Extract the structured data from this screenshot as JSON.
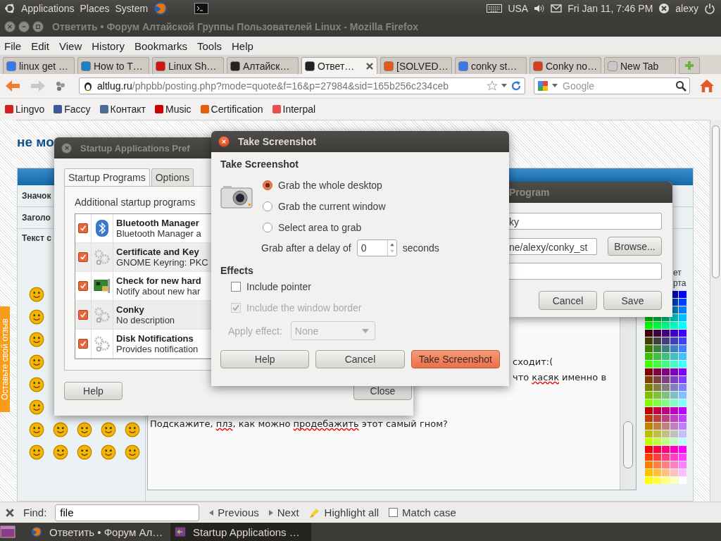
{
  "top_panel": {
    "menus": [
      "Applications",
      "Places",
      "System"
    ],
    "keyboard_layout": "USA",
    "clock": "Fri Jan 11, 7:46 PM",
    "user": "alexy"
  },
  "browser": {
    "title": "Ответить • Форум Алтайской Группы Пользователей Linux - Mozilla Firefox",
    "menu": [
      "File",
      "Edit",
      "View",
      "History",
      "Bookmarks",
      "Tools",
      "Help"
    ],
    "tabs": [
      {
        "label": "linux get …",
        "color": "#3b78e7",
        "selected": false
      },
      {
        "label": "How to T…",
        "color": "#1e7fc4",
        "selected": false
      },
      {
        "label": "Linux Sh…",
        "color": "#d21414",
        "selected": false
      },
      {
        "label": "Алтайск…",
        "color": "#222222",
        "selected": false
      },
      {
        "label": "Ответ…",
        "color": "#222222",
        "selected": true
      },
      {
        "label": "[SOLVED…",
        "color": "#e05a1e",
        "selected": false
      },
      {
        "label": "conky st…",
        "color": "#3b78e7",
        "selected": false
      },
      {
        "label": "Conky no…",
        "color": "#d8401c",
        "selected": false
      },
      {
        "label": "New Tab",
        "color": "#c8c8c8",
        "selected": false
      }
    ],
    "url_host": "altlug.ru",
    "url_path": "/phpbb/posting.php?mode=quote&f=16&p=27984&sid=165b256c234ceb",
    "search_placeholder": "Google",
    "bookmarks": [
      {
        "label": "Lingvo",
        "color": "#d42020"
      },
      {
        "label": "Faccy",
        "color": "#3b5998"
      },
      {
        "label": "Контакт",
        "color": "#4a6e9a"
      },
      {
        "label": "Music",
        "color": "#cc0000"
      },
      {
        "label": "Certification",
        "color": "#e06010"
      },
      {
        "label": "Interpal",
        "color": "#e85050"
      }
    ]
  },
  "page": {
    "heading": "не мо",
    "form_labels": [
      "Значок",
      "Заголо",
      "Текст с"
    ],
    "feedback_tab": "Оставьте свой отзыв",
    "message_lines": [
      {
        "kind": "tail",
        "segments": [
          {
            "text": "сходит:(",
            "misspelled": false
          }
        ]
      },
      {
        "kind": "tail",
        "segments": [
          {
            "text": "что ",
            "misspelled": false
          },
          {
            "text": "касяк",
            "misspelled": true
          },
          {
            "text": " именно в",
            "misspelled": false
          }
        ]
      },
      {
        "kind": "full",
        "segments": [
          {
            "text": "Подскажите, ",
            "misspelled": false
          },
          {
            "text": "плз",
            "misspelled": true
          },
          {
            "text": ", как можно ",
            "misspelled": false
          },
          {
            "text": "продебажить",
            "misspelled": true
          },
          {
            "text": " этот самый гном?",
            "misspelled": false
          }
        ]
      }
    ],
    "palette_labels": [
      "ет",
      "рта"
    ]
  },
  "startup_window": {
    "title": "Startup Applications Pref",
    "tabs": [
      {
        "label": "Startup Programs",
        "selected": true
      },
      {
        "label": "Options",
        "selected": false
      }
    ],
    "intro": "Additional startup programs",
    "items": [
      {
        "name": "Bluetooth Manager",
        "description": "Bluetooth Manager a",
        "checked": true,
        "kind": "bluetooth"
      },
      {
        "name": "Certificate and Key",
        "description": "GNOME Keyring: PKC",
        "checked": true,
        "kind": "gears"
      },
      {
        "name": "Check for new hard",
        "description": "Notify about new har",
        "checked": true,
        "kind": "hardware"
      },
      {
        "name": "Conky",
        "description": "No description",
        "checked": true,
        "kind": "gears"
      },
      {
        "name": "Disk Notifications",
        "description": "Provides notification",
        "checked": true,
        "kind": "gears"
      }
    ],
    "buttons": [
      "Help",
      "Close"
    ]
  },
  "screenshot_dialog": {
    "title": "Take Screenshot",
    "heading": "Take Screenshot",
    "grab_options": [
      {
        "label": "Grab the whole desktop",
        "selected": true
      },
      {
        "label": "Grab the current window",
        "selected": false
      },
      {
        "label": "Select area to grab",
        "selected": false
      }
    ],
    "delay_label": "Grab after a delay of",
    "delay_value": "0",
    "delay_unit": "seconds",
    "effects_heading": "Effects",
    "effects": [
      {
        "label": "Include pointer",
        "checked": false,
        "disabled": false
      },
      {
        "label": "Include the window border",
        "checked": true,
        "disabled": true
      }
    ],
    "apply_effect": {
      "label": "Apply effect:",
      "value": "None",
      "disabled": true
    },
    "buttons": [
      {
        "label": "Help",
        "primary": false
      },
      {
        "label": "Cancel",
        "primary": false
      },
      {
        "label": "Take Screenshot",
        "primary": true
      }
    ]
  },
  "add_program_dialog": {
    "title": "Program",
    "name_value": "ky",
    "command_value": "ne/alexy/conky_st",
    "browse": "Browse...",
    "buttons": [
      "Cancel",
      "Save"
    ]
  },
  "find_bar": {
    "label": "Find:",
    "value": "file",
    "previous": "Previous",
    "next": "Next",
    "highlight_all": "Highlight all",
    "match_case": {
      "label": "Match case",
      "checked": false
    }
  },
  "taskbar": [
    {
      "label": "Ответить • Форум Ал…",
      "selected": false,
      "kind": "browser"
    },
    {
      "label": "Startup Applications …",
      "selected": true,
      "kind": "startup"
    }
  ]
}
